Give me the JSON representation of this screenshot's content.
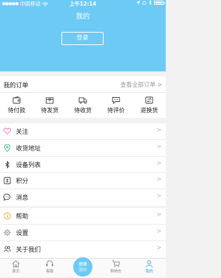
{
  "status_bar": {
    "carrier": "中国移动",
    "time": "上午12:14"
  },
  "header": {
    "title": "我的",
    "login_label": "登录"
  },
  "orders": {
    "title": "我的订单",
    "view_all": "查看全部订单 >",
    "tabs": [
      {
        "label": "待付款",
        "icon": "wallet-icon"
      },
      {
        "label": "待发货",
        "icon": "box-icon"
      },
      {
        "label": "待收货",
        "icon": "truck-icon"
      },
      {
        "label": "待评价",
        "icon": "comment-icon"
      },
      {
        "label": "退换货",
        "icon": "return-icon"
      }
    ]
  },
  "menu1": [
    {
      "label": "关注",
      "icon": "heart-icon"
    },
    {
      "label": "收货地址",
      "icon": "location-icon"
    },
    {
      "label": "设备列表",
      "icon": "bluetooth-icon"
    },
    {
      "label": "积分",
      "icon": "points-icon"
    },
    {
      "label": "消息",
      "icon": "message-icon"
    }
  ],
  "menu2": [
    {
      "label": "帮助",
      "icon": "info-icon"
    },
    {
      "label": "设置",
      "icon": "gear-icon"
    },
    {
      "label": "关于我们",
      "icon": "people-icon"
    }
  ],
  "chevron": ">",
  "tabbar": {
    "items": [
      {
        "label": "首页",
        "icon": "home-icon"
      },
      {
        "label": "客服",
        "icon": "service-icon"
      },
      {
        "label": "购物车",
        "icon": "cart-icon"
      },
      {
        "label": "我的",
        "icon": "user-icon"
      }
    ],
    "center_label_1": "健康",
    "center_label_2": "加分"
  },
  "colors": {
    "accent": "#6dcaf5",
    "active_tab": "#3aa0e8"
  }
}
